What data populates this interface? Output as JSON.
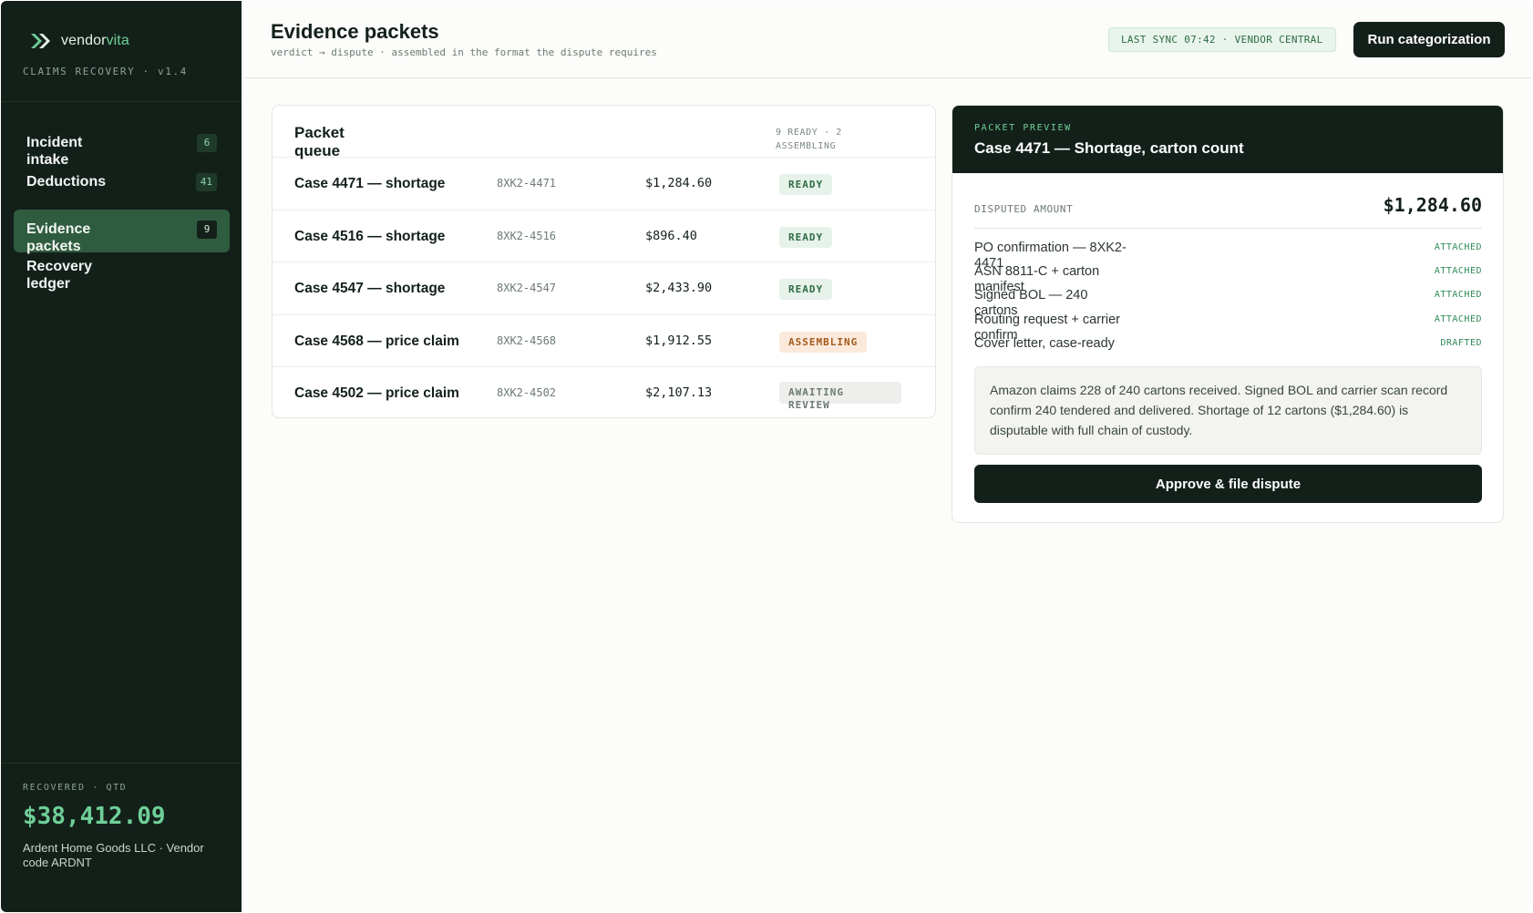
{
  "brand": {
    "name_prefix": "vendor",
    "name_accent": "vita",
    "product": "CLAIMS RECOVERY · v1.4",
    "accent_color": "#6fcf97"
  },
  "sidebar": {
    "items": [
      {
        "label": "Incident intake",
        "count": "6",
        "active": false
      },
      {
        "label": "Deductions",
        "count": "41",
        "active": false
      },
      {
        "label": "Evidence packets",
        "count": "9",
        "active": true
      },
      {
        "label": "Recovery ledger",
        "count": "",
        "active": false
      }
    ],
    "recovered_label": "RECOVERED · QTD",
    "recovered_amount": "$38,412.09",
    "vendor_info": "Ardent Home Goods LLC · Vendor code ARDNT"
  },
  "header": {
    "title": "Evidence packets",
    "subtitle": "verdict → dispute · assembled in the format the dispute requires",
    "sync_status": "LAST SYNC 07:42 · VENDOR CENTRAL",
    "run_button": "Run categorization"
  },
  "queue": {
    "title": "Packet queue",
    "count_summary": "9 READY · 2 ASSEMBLING",
    "rows": [
      {
        "name": "Case 4471 — shortage",
        "code": "8XK2-4471",
        "amount": "$1,284.60",
        "status": "READY"
      },
      {
        "name": "Case 4516 — shortage",
        "code": "8XK2-4516",
        "amount": "$896.40",
        "status": "READY"
      },
      {
        "name": "Case 4547 — shortage",
        "code": "8XK2-4547",
        "amount": "$2,433.90",
        "status": "READY"
      },
      {
        "name": "Case 4568 — price claim",
        "code": "8XK2-4568",
        "amount": "$1,912.55",
        "status": "ASSEMBLING"
      },
      {
        "name": "Case 4502 — price claim",
        "code": "8XK2-4502",
        "amount": "$2,107.13",
        "status": "AWAITING REVIEW"
      }
    ]
  },
  "preview": {
    "kicker": "PACKET PREVIEW",
    "title": "Case 4471 — Shortage, carton count",
    "disputed_label": "DISPUTED AMOUNT",
    "disputed_amount": "$1,284.60",
    "documents": [
      {
        "name": "PO confirmation — 8XK2-4471",
        "state": "ATTACHED"
      },
      {
        "name": "ASN 8811-C + carton manifest",
        "state": "ATTACHED"
      },
      {
        "name": "Signed BOL — 240 cartons",
        "state": "ATTACHED"
      },
      {
        "name": "Routing request + carrier confirm",
        "state": "ATTACHED"
      },
      {
        "name": "Cover letter, case-ready",
        "state": "DRAFTED"
      }
    ],
    "summary": "Amazon claims 228 of 240 cartons received. Signed BOL and carrier scan record confirm 240 tendered and delivered. Shortage of 12 cartons ($1,284.60) is disputable with full chain of custody.",
    "approve_button": "Approve & file dispute"
  }
}
